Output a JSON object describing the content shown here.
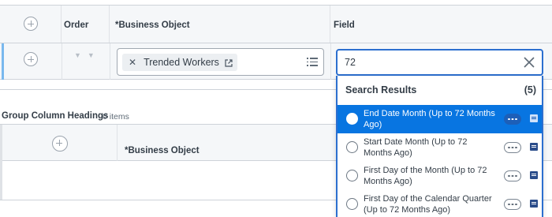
{
  "grid": {
    "headers": {
      "order": "Order",
      "business_object": "*Business Object",
      "field": "Field"
    },
    "row": {
      "business_object_value": "Trended Workers"
    }
  },
  "search": {
    "value": "72",
    "results_title": "Search Results",
    "results_count": "(5)",
    "results": [
      {
        "label": "End Date Month (Up to 72 Months Ago)",
        "selected": true
      },
      {
        "label": "Start Date Month (Up to 72 Months Ago)",
        "selected": false
      },
      {
        "label": "First Day of the Month (Up to 72 Months Ago)",
        "selected": false
      },
      {
        "label": "First Day of the Calendar Quarter (Up to 72 Months Ago)",
        "selected": false
      }
    ]
  },
  "group_column_headings": {
    "title": "Group Column Headings",
    "count": "0 items",
    "header_business_object": "*Business Object"
  },
  "icons": {
    "add": "plus-circle-icon",
    "sort": "sort-arrows-icon",
    "remove": "x-icon",
    "external_link": "external-link-icon",
    "prompt_list": "list-icon",
    "clear": "close-icon",
    "related_actions": "ellipsis-icon",
    "report": "report-icon"
  },
  "colors": {
    "accent": "#0875e1",
    "focus_border": "#2c6fcf",
    "header_bg": "#f5f7f9"
  }
}
